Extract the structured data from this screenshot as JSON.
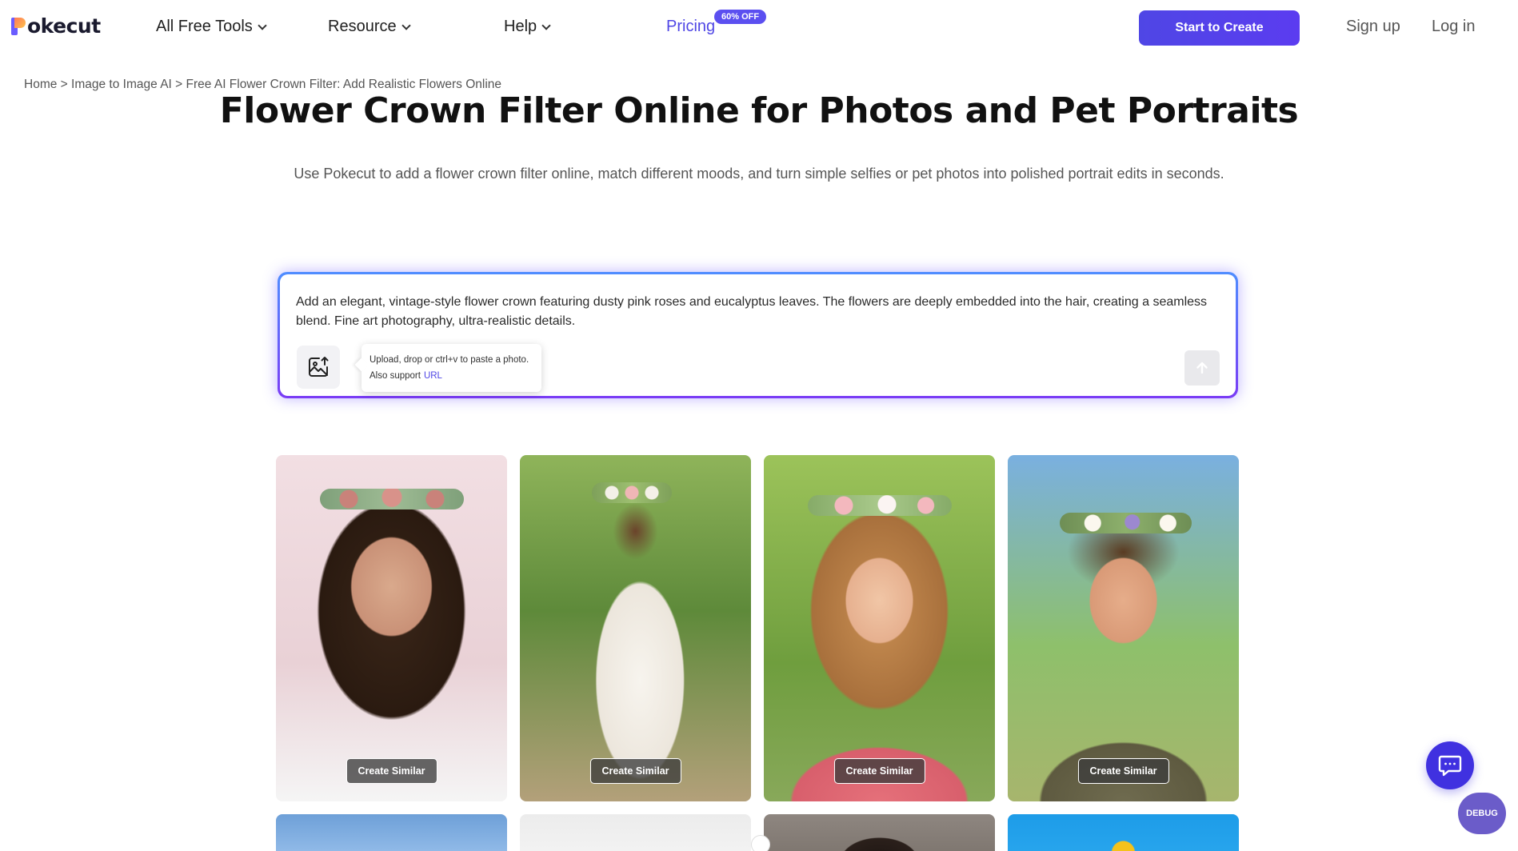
{
  "header": {
    "logo_text": "okecut",
    "nav": [
      {
        "label": "All Free Tools"
      },
      {
        "label": "Resource"
      },
      {
        "label": "Help"
      },
      {
        "label": "Pricing"
      }
    ],
    "pricing_badge": "60% OFF",
    "start_button": "Start to Create",
    "signup": "Sign up",
    "login": "Log in"
  },
  "breadcrumb": {
    "home": "Home",
    "sep": ">",
    "parent": "Image to Image AI",
    "current": "Free AI Flower Crown Filter: Add Realistic Flowers Online"
  },
  "hero": {
    "title": "Flower Crown Filter Online for Photos and Pet Portraits",
    "subtitle": "Use Pokecut to add a flower crown filter online, match different moods, and turn simple selfies or pet photos into polished portrait edits in seconds."
  },
  "prompt": {
    "text": "Add an elegant, vintage-style flower crown featuring dusty pink roses and eucalyptus leaves. The flowers are deeply embedded into the hair, creating a seamless blend. Fine art photography, ultra-realistic details.",
    "tooltip_line1": "Upload, drop or ctrl+v to paste a photo.",
    "tooltip_line2": "Also support",
    "tooltip_url": "URL"
  },
  "gallery": {
    "create_similar": "Create Similar"
  },
  "floating": {
    "debug_label": "DEBUG"
  },
  "colors": {
    "accent": "#4f46e5",
    "badge": "#5b4ff0",
    "chat": "#4031e0"
  }
}
